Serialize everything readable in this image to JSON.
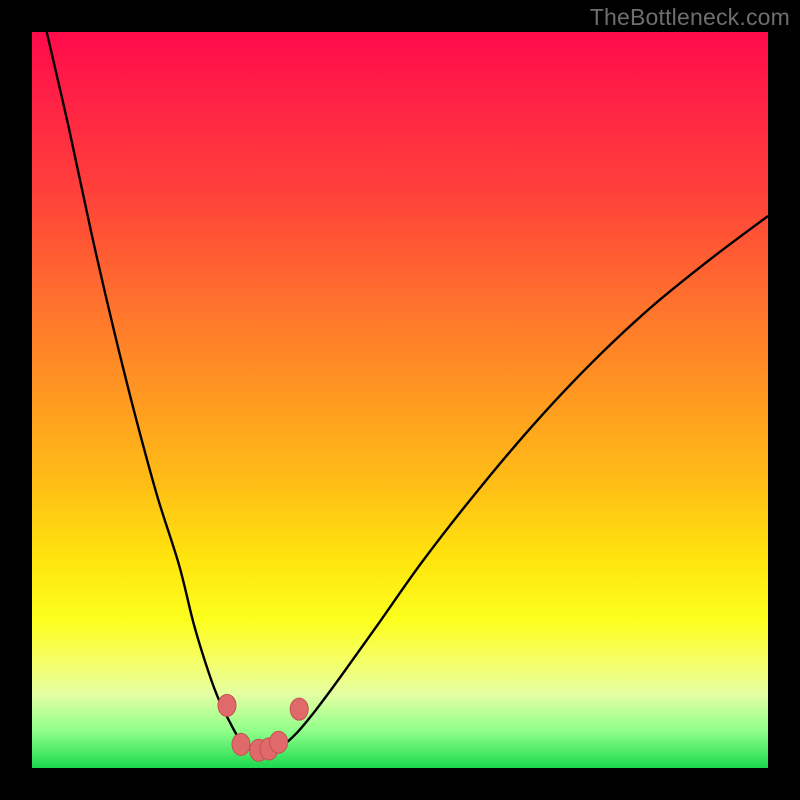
{
  "watermark": "TheBottleneck.com",
  "colors": {
    "frame": "#000000",
    "curve": "#000000",
    "marker_fill": "#e06a6a",
    "marker_stroke": "#c84f4f",
    "gradient_stops": [
      "#ff0a4a",
      "#ff6f2e",
      "#ffe60d",
      "#1bd94d"
    ]
  },
  "chart_data": {
    "type": "line",
    "title": "",
    "xlabel": "",
    "ylabel": "",
    "xlim": [
      0,
      100
    ],
    "ylim": [
      0,
      100
    ],
    "x": [
      2,
      5,
      8,
      11,
      14,
      17,
      20,
      22,
      24,
      25.5,
      27,
      28,
      29,
      30,
      31,
      32.5,
      34,
      36,
      38.5,
      42,
      47,
      53,
      60,
      68,
      76,
      84,
      92,
      100
    ],
    "values": [
      100,
      87,
      73,
      60,
      48,
      37,
      27.5,
      19.5,
      13,
      9,
      6,
      4.2,
      3,
      2.3,
      2.1,
      2.3,
      3,
      4.8,
      7.8,
      12.5,
      19.5,
      28,
      37,
      46.5,
      55,
      62.5,
      69,
      75
    ],
    "markers": [
      {
        "x": 26.5,
        "y": 8.5
      },
      {
        "x": 28.4,
        "y": 3.2
      },
      {
        "x": 30.8,
        "y": 2.4
      },
      {
        "x": 32.2,
        "y": 2.6
      },
      {
        "x": 33.5,
        "y": 3.5
      },
      {
        "x": 36.3,
        "y": 8.0
      }
    ]
  }
}
